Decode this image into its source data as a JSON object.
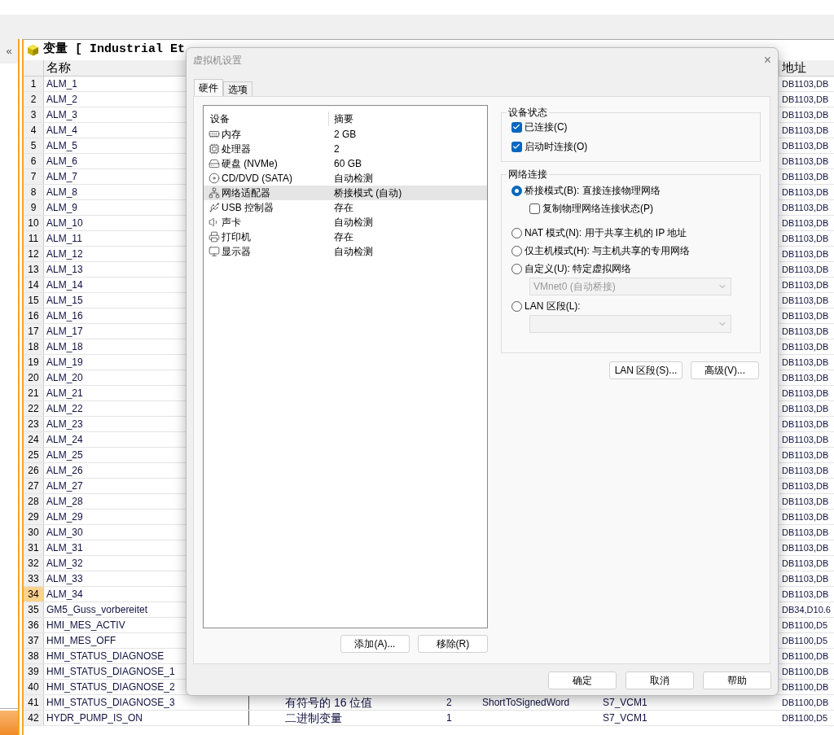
{
  "sidebar": {
    "collapse_button": "«"
  },
  "table": {
    "title": "变量 [ Industrial Et",
    "name_header": "名称",
    "address_header": "地址",
    "rows": [
      {
        "num": "1",
        "name": "ALM_1",
        "selected": false,
        "address": "DB1103,DB"
      },
      {
        "num": "2",
        "name": "ALM_2",
        "selected": false,
        "address": "DB1103,DB"
      },
      {
        "num": "3",
        "name": "ALM_3",
        "selected": false,
        "address": "DB1103,DB"
      },
      {
        "num": "4",
        "name": "ALM_4",
        "selected": false,
        "address": "DB1103,DB"
      },
      {
        "num": "5",
        "name": "ALM_5",
        "selected": false,
        "address": "DB1103,DB"
      },
      {
        "num": "6",
        "name": "ALM_6",
        "selected": false,
        "address": "DB1103,DB"
      },
      {
        "num": "7",
        "name": "ALM_7",
        "selected": false,
        "address": "DB1103,DB"
      },
      {
        "num": "8",
        "name": "ALM_8",
        "selected": false,
        "address": "DB1103,DB"
      },
      {
        "num": "9",
        "name": "ALM_9",
        "selected": false,
        "address": "DB1103,DB"
      },
      {
        "num": "10",
        "name": "ALM_10",
        "selected": false,
        "address": "DB1103,DB"
      },
      {
        "num": "11",
        "name": "ALM_11",
        "selected": false,
        "address": "DB1103,DB"
      },
      {
        "num": "12",
        "name": "ALM_12",
        "selected": false,
        "address": "DB1103,DB"
      },
      {
        "num": "13",
        "name": "ALM_13",
        "selected": false,
        "address": "DB1103,DB"
      },
      {
        "num": "14",
        "name": "ALM_14",
        "selected": false,
        "address": "DB1103,DB"
      },
      {
        "num": "15",
        "name": "ALM_15",
        "selected": false,
        "address": "DB1103,DB"
      },
      {
        "num": "16",
        "name": "ALM_16",
        "selected": false,
        "address": "DB1103,DB"
      },
      {
        "num": "17",
        "name": "ALM_17",
        "selected": false,
        "address": "DB1103,DB"
      },
      {
        "num": "18",
        "name": "ALM_18",
        "selected": false,
        "address": "DB1103,DB"
      },
      {
        "num": "19",
        "name": "ALM_19",
        "selected": false,
        "address": "DB1103,DB"
      },
      {
        "num": "20",
        "name": "ALM_20",
        "selected": false,
        "address": "DB1103,DB"
      },
      {
        "num": "21",
        "name": "ALM_21",
        "selected": false,
        "address": "DB1103,DB"
      },
      {
        "num": "22",
        "name": "ALM_22",
        "selected": false,
        "address": "DB1103,DB"
      },
      {
        "num": "23",
        "name": "ALM_23",
        "selected": false,
        "address": "DB1103,DB"
      },
      {
        "num": "24",
        "name": "ALM_24",
        "selected": false,
        "address": "DB1103,DB"
      },
      {
        "num": "25",
        "name": "ALM_25",
        "selected": false,
        "address": "DB1103,DB"
      },
      {
        "num": "26",
        "name": "ALM_26",
        "selected": false,
        "address": "DB1103,DB"
      },
      {
        "num": "27",
        "name": "ALM_27",
        "selected": false,
        "address": "DB1103,DB"
      },
      {
        "num": "28",
        "name": "ALM_28",
        "selected": false,
        "address": "DB1103,DB"
      },
      {
        "num": "29",
        "name": "ALM_29",
        "selected": false,
        "address": "DB1103,DB"
      },
      {
        "num": "30",
        "name": "ALM_30",
        "selected": false,
        "address": "DB1103,DB"
      },
      {
        "num": "31",
        "name": "ALM_31",
        "selected": false,
        "address": "DB1103,DB"
      },
      {
        "num": "32",
        "name": "ALM_32",
        "selected": false,
        "address": "DB1103,DB"
      },
      {
        "num": "33",
        "name": "ALM_33",
        "selected": false,
        "address": "DB1103,DB"
      },
      {
        "num": "34",
        "name": "ALM_34",
        "selected": true,
        "address": "DB1103,DB"
      },
      {
        "num": "35",
        "name": "GM5_Guss_vorbereitet",
        "selected": false,
        "address": "DB34,D10.6"
      },
      {
        "num": "36",
        "name": "HMI_MES_ACTIV",
        "selected": false,
        "address": "DB1100,D5"
      },
      {
        "num": "37",
        "name": "HMI_MES_OFF",
        "selected": false,
        "address": "DB1100,D5"
      },
      {
        "num": "38",
        "name": "HMI_STATUS_DIAGNOSE",
        "selected": false,
        "address": "DB1100,DB"
      },
      {
        "num": "39",
        "name": "HMI_STATUS_DIAGNOSE_1",
        "selected": false,
        "address": "DB1100,DB"
      },
      {
        "num": "40",
        "name": "HMI_STATUS_DIAGNOSE_2",
        "selected": false,
        "address": "DB1100,DB"
      },
      {
        "num": "41",
        "name": "HMI_STATUS_DIAGNOSE_3",
        "selected": false,
        "column_4": "有符号的 16 位值",
        "column_5": "2",
        "column_6": "ShortToSignedWord",
        "column_7": "S7_VCM1",
        "address": "DB1100,DB"
      },
      {
        "num": "42",
        "name": "HYDR_PUMP_IS_ON",
        "selected": false,
        "column_4": "二进制变量",
        "column_5": "1",
        "column_7": "S7_VCM1",
        "address": "DB1100,D5"
      }
    ]
  },
  "dialog": {
    "title": "虚拟机设置",
    "close": "×",
    "tabs": [
      {
        "label": "硬件",
        "selected": true
      },
      {
        "label": "选项",
        "selected": false
      }
    ],
    "devices": {
      "columns": [
        "设备",
        "摘要"
      ],
      "items": [
        {
          "kind": "memory",
          "name": "内存",
          "summary": "2 GB",
          "selected": false
        },
        {
          "kind": "cpu",
          "name": "处理器",
          "summary": "2",
          "selected": false
        },
        {
          "kind": "disk",
          "name": "硬盘 (NVMe)",
          "summary": "60 GB",
          "selected": false
        },
        {
          "kind": "cd",
          "name": "CD/DVD (SATA)",
          "summary": "自动检测",
          "selected": false
        },
        {
          "kind": "network",
          "name": "网络适配器",
          "summary": "桥接模式 (自动)",
          "selected": true
        },
        {
          "kind": "usb",
          "name": "USB 控制器",
          "summary": "存在",
          "selected": false
        },
        {
          "kind": "sound",
          "name": "声卡",
          "summary": "自动检测",
          "selected": false
        },
        {
          "kind": "printer",
          "name": "打印机",
          "summary": "存在",
          "selected": false
        },
        {
          "kind": "display",
          "name": "显示器",
          "summary": "自动检测",
          "selected": false
        }
      ],
      "buttons": [
        "添加(A)...",
        "移除(R)"
      ]
    },
    "device_status": {
      "title": "设备状态",
      "options": [
        {
          "label": "已连接(C)",
          "checked": true
        },
        {
          "label": "启动时连接(O)",
          "checked": true
        }
      ]
    },
    "network": {
      "title": "网络连接",
      "options": [
        {
          "kind": "radio",
          "label": "桥接模式(B): 直接连接物理网络",
          "selected": true
        },
        {
          "kind": "checkbox",
          "label": "复制物理网络连接状态(P)",
          "checked": false
        },
        {
          "kind": "radio",
          "label": "NAT 模式(N): 用于共享主机的 IP 地址",
          "selected": false
        },
        {
          "kind": "radio",
          "label": "仅主机模式(H): 与主机共享的专用网络",
          "selected": false
        },
        {
          "kind": "radio",
          "label": "自定义(U): 特定虚拟网络",
          "selected": false
        },
        {
          "kind": "select",
          "value": "VMnet0 (自动桥接)",
          "disabled": true
        },
        {
          "kind": "radio",
          "label": "LAN 区段(L):",
          "selected": false
        },
        {
          "kind": "select",
          "disabled": true
        }
      ],
      "buttons": [
        "LAN 区段(S)...",
        "高级(V)..."
      ]
    },
    "buttons": [
      "确定",
      "取消",
      "帮助"
    ]
  }
}
